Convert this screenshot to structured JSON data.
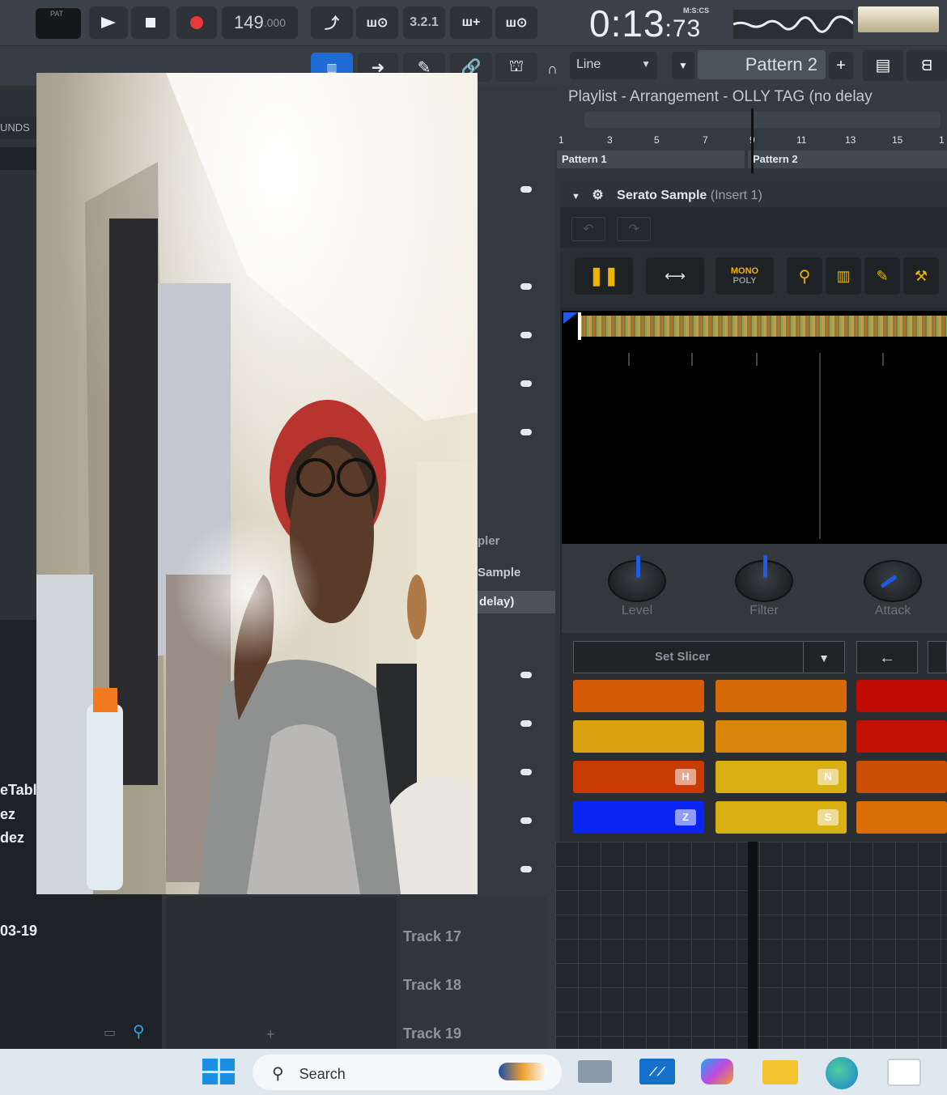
{
  "toolbar": {
    "pat_label": "PAT",
    "tempo": "149",
    "tempo_dec": ".000",
    "time_main": "0:13",
    "time_frac": ":73",
    "time_unit": "M:S:CS",
    "snap_label": "Line",
    "pattern_label": "Pattern 2"
  },
  "browser": {
    "header_label": "UNDS",
    "items": [
      "eTabl",
      "ez",
      "dez"
    ],
    "date": "03-19"
  },
  "channels": {
    "labels": [
      "pler",
      "Sample",
      "delay)"
    ]
  },
  "playlist": {
    "title": "Playlist - Arrangement",
    "arrangement": "OLLY TAG (no delay",
    "ruler": [
      "1",
      "3",
      "5",
      "7",
      "9",
      "11",
      "13",
      "15",
      "1"
    ],
    "patterns": [
      "Pattern 1",
      "Pattern 2"
    ],
    "tracks": [
      "Track 17",
      "Track 18",
      "Track 19"
    ]
  },
  "serato": {
    "title": "Serato Sample",
    "insert": "(Insert 1)",
    "mode_top": "MONO",
    "mode_bottom": "POLY",
    "knobs": [
      "Level",
      "Filter",
      "Attack"
    ],
    "slicer_label": "Set Slicer",
    "pads": [
      {
        "color": "#d45a06",
        "key": ""
      },
      {
        "color": "#d56a06",
        "key": ""
      },
      {
        "color": "#c00a04",
        "key": ""
      },
      {
        "color": "#d9a20e",
        "key": ""
      },
      {
        "color": "#d9870a",
        "key": ""
      },
      {
        "color": "#c11005",
        "key": ""
      },
      {
        "color": "#c93a06",
        "key": "H"
      },
      {
        "color": "#d9b012",
        "key": "N"
      },
      {
        "color": "#cc4d06",
        "key": ""
      },
      {
        "color": "#0a24f2",
        "key": "Z"
      },
      {
        "color": "#d9b012",
        "key": "S"
      },
      {
        "color": "#d96e06",
        "key": ""
      }
    ]
  },
  "taskbar": {
    "search_label": "Search"
  }
}
